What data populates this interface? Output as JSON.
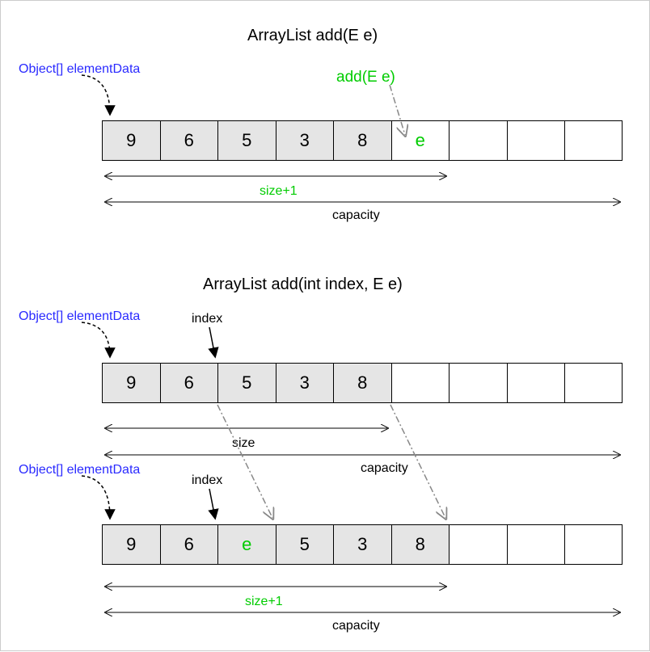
{
  "title1": "ArrayList add(E e)",
  "title2": "ArrayList add(int index, E e)",
  "labels": {
    "elementData": "Object[] elementData",
    "addCall": "add(E e)",
    "sizePlus1": "size+1",
    "capacity": "capacity",
    "size": "size",
    "index": "index"
  },
  "arrays": {
    "a1": [
      {
        "v": "9",
        "filled": true
      },
      {
        "v": "6",
        "filled": true
      },
      {
        "v": "5",
        "filled": true
      },
      {
        "v": "3",
        "filled": true
      },
      {
        "v": "8",
        "filled": true
      },
      {
        "v": "e",
        "filled": false,
        "green": true
      },
      {
        "v": "",
        "filled": false
      },
      {
        "v": "",
        "filled": false
      },
      {
        "v": "",
        "filled": false
      }
    ],
    "a2": [
      {
        "v": "9",
        "filled": true
      },
      {
        "v": "6",
        "filled": true
      },
      {
        "v": "5",
        "filled": true
      },
      {
        "v": "3",
        "filled": true
      },
      {
        "v": "8",
        "filled": true
      },
      {
        "v": "",
        "filled": false
      },
      {
        "v": "",
        "filled": false
      },
      {
        "v": "",
        "filled": false
      },
      {
        "v": "",
        "filled": false
      }
    ],
    "a3": [
      {
        "v": "9",
        "filled": true
      },
      {
        "v": "6",
        "filled": true
      },
      {
        "v": "e",
        "filled": true,
        "green": true
      },
      {
        "v": "5",
        "filled": true
      },
      {
        "v": "3",
        "filled": true
      },
      {
        "v": "8",
        "filled": true
      },
      {
        "v": "",
        "filled": false
      },
      {
        "v": "",
        "filled": false
      },
      {
        "v": "",
        "filled": false
      }
    ]
  }
}
